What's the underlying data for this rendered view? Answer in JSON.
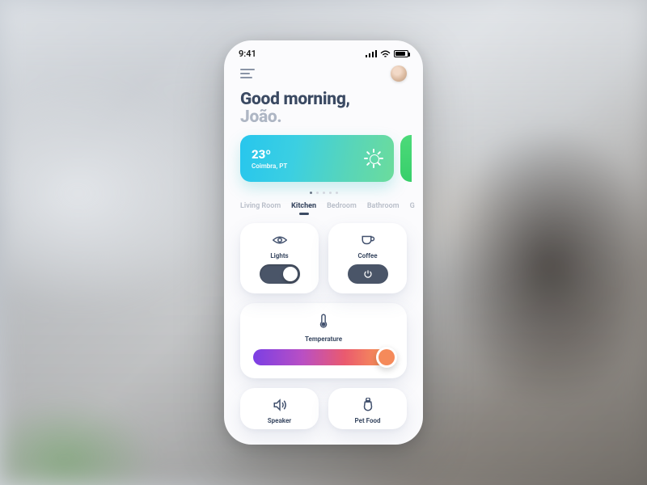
{
  "status": {
    "time": "9:41"
  },
  "greeting": {
    "line1": "Good morning,",
    "line2": "João."
  },
  "weather": {
    "temp": "23º",
    "location": "Coimbra, PT"
  },
  "pager": {
    "count": 5,
    "active": 0
  },
  "tabs": [
    {
      "label": "Living Room",
      "active": false
    },
    {
      "label": "Kitchen",
      "active": true
    },
    {
      "label": "Bedroom",
      "active": false
    },
    {
      "label": "Bathroom",
      "active": false
    },
    {
      "label": "G",
      "active": false
    }
  ],
  "devices": {
    "lights": {
      "label": "Lights",
      "icon": "eye-icon",
      "state": "on"
    },
    "coffee": {
      "label": "Coffee",
      "icon": "coffee-cup-icon",
      "state": "off"
    },
    "temperature": {
      "label": "Temperature",
      "icon": "thermometer-icon",
      "value": 0.92
    },
    "speaker": {
      "label": "Speaker",
      "icon": "speaker-icon"
    },
    "petfood": {
      "label": "Pet Food",
      "icon": "pet-food-icon"
    }
  },
  "colors": {
    "text_primary": "#3b4a63",
    "text_muted": "#aeb6c4",
    "weather_gradient": [
      "#27c6ed",
      "#6bdc9c"
    ],
    "temp_gradient": [
      "#7b3fe4",
      "#f58a5a"
    ],
    "control_bg": "#4a5568"
  }
}
